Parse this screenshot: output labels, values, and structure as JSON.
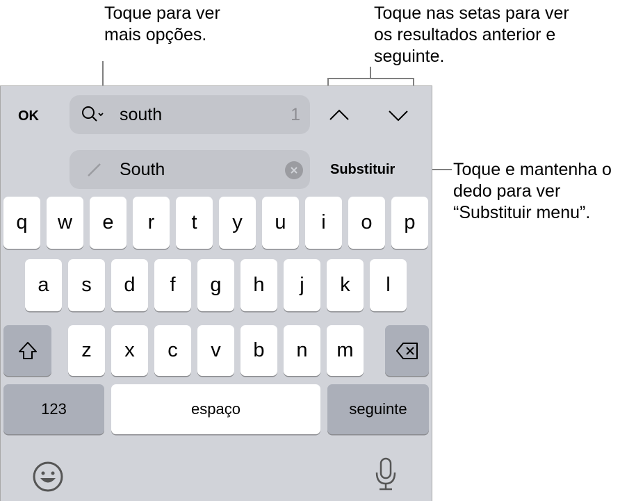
{
  "annotations": {
    "more_options": "Toque para ver mais opções.",
    "arrows": "Toque nas setas para ver os resultados anterior e seguinte.",
    "replace": "Toque e mantenha o dedo para ver “Substituir menu”."
  },
  "find_bar": {
    "done_label": "OK",
    "search_value": "south",
    "match_count": "1",
    "replace_value": "South",
    "replace_label": "Substituir"
  },
  "keyboard": {
    "row1": [
      "q",
      "w",
      "e",
      "r",
      "t",
      "y",
      "u",
      "i",
      "o",
      "p"
    ],
    "row2": [
      "a",
      "s",
      "d",
      "f",
      "g",
      "h",
      "j",
      "k",
      "l"
    ],
    "row3": [
      "z",
      "x",
      "c",
      "v",
      "b",
      "n",
      "m"
    ],
    "numbers_label": "123",
    "space_label": "espaço",
    "return_label": "seguinte"
  },
  "colors": {
    "keyboard_bg": "#d1d3d9",
    "field_bg": "#c3c5cb",
    "dark_key": "#abafb9"
  }
}
